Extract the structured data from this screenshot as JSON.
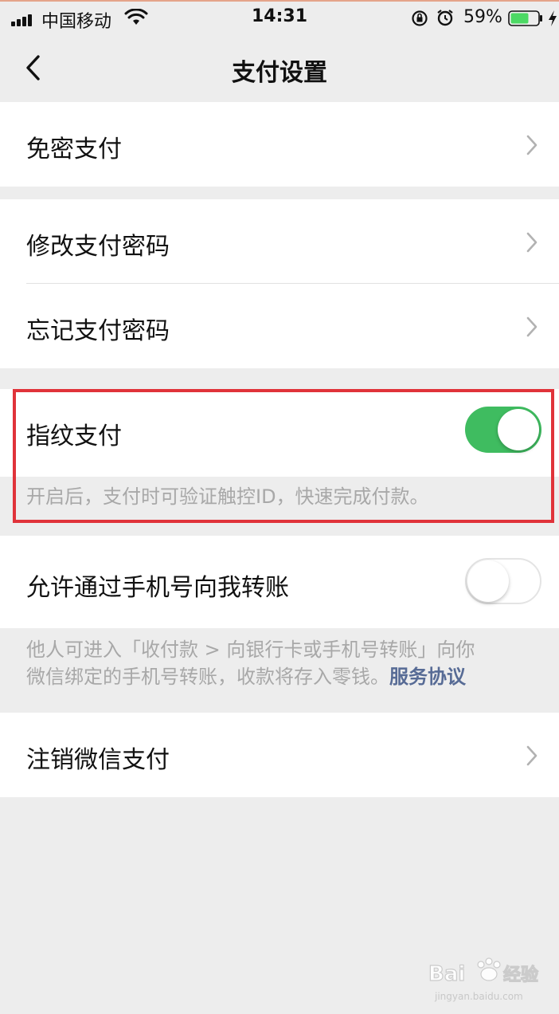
{
  "status_bar": {
    "carrier": "中国移动",
    "time": "14:31",
    "battery_percent": "59%",
    "battery_level": 0.59,
    "icons": [
      "signal-icon",
      "wifi-icon",
      "rotation-lock-icon",
      "alarm-icon",
      "battery-icon",
      "charging-bolt-icon"
    ]
  },
  "nav": {
    "title": "支付设置",
    "back_icon": "chevron-left-icon"
  },
  "sections": {
    "password_free": {
      "label": "免密支付"
    },
    "change_password": {
      "label": "修改支付密码"
    },
    "forgot_password": {
      "label": "忘记支付密码"
    },
    "fingerprint": {
      "label": "指纹支付",
      "enabled": true,
      "hint": "开启后，支付时可验证触控ID，快速完成付款。"
    },
    "phone_transfer": {
      "label": "允许通过手机号向我转账",
      "enabled": false,
      "hint_line1": "他人可进入「收付款 > 向银行卡或手机号转账」向你",
      "hint_line2": "微信绑定的手机号转账，收款将存入零钱。",
      "hint_link": "服务协议"
    },
    "deactivate": {
      "label": "注销微信支付"
    }
  },
  "colors": {
    "toggle_on": "#3fbc60",
    "highlight": "#e0333a",
    "link": "#576b95",
    "background": "#ededed"
  }
}
